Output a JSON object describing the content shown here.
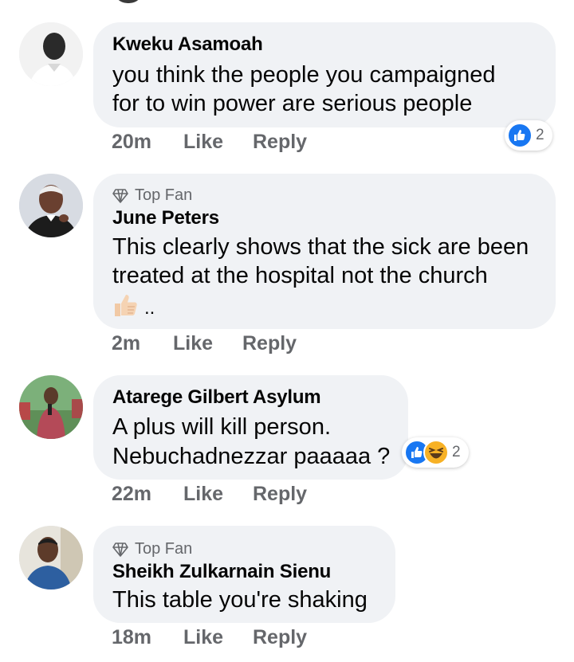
{
  "comments": [
    {
      "author": "Kweku Asamoah",
      "top_fan": false,
      "lines": [
        "you think the people you campaigned",
        "for to win power are serious people"
      ],
      "time": "20m",
      "like_label": "Like",
      "reply_label": "Reply",
      "reactions": {
        "types": [
          "like"
        ],
        "count": "2"
      }
    },
    {
      "author": "June Peters",
      "top_fan": true,
      "top_fan_label": "Top Fan",
      "lines": [
        "This clearly shows that the sick are been",
        "treated at the hospital not the church"
      ],
      "emoji_tail": "..",
      "time": "2m",
      "like_label": "Like",
      "reply_label": "Reply"
    },
    {
      "author": "Atarege Gilbert Asylum",
      "top_fan": false,
      "lines": [
        "A plus will kill person.",
        "Nebuchadnezzar paaaaa ?"
      ],
      "time": "22m",
      "like_label": "Like",
      "reply_label": "Reply",
      "reactions": {
        "types": [
          "like",
          "haha"
        ],
        "count": "2"
      }
    },
    {
      "author": "Sheikh Zulkarnain Sienu",
      "top_fan": true,
      "top_fan_label": "Top Fan",
      "lines": [
        "This table you're shaking"
      ],
      "time": "18m",
      "like_label": "Like",
      "reply_label": "Reply"
    }
  ],
  "colors": {
    "bubble": "#f0f2f5",
    "meta_text": "#65676b",
    "like_blue": "#1877f2",
    "haha_yellow": "#f7b125"
  }
}
